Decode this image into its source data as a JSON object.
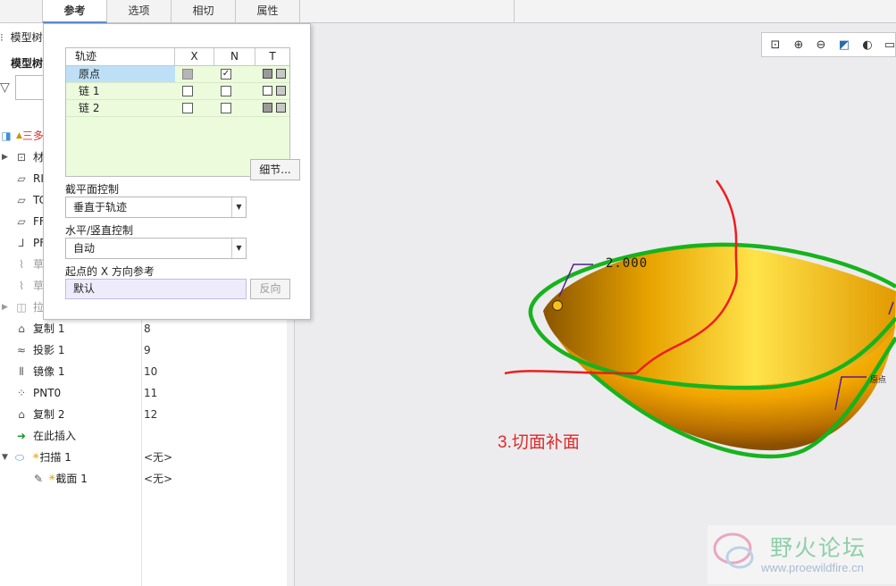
{
  "tabs": [
    {
      "label": "参考",
      "active": true
    },
    {
      "label": "选项",
      "active": false
    },
    {
      "label": "相切",
      "active": false
    },
    {
      "label": "属性",
      "active": false
    }
  ],
  "model_tree": {
    "title": "模型树",
    "subheader": "模型树",
    "rows": [
      {
        "label": "三多",
        "value": "",
        "root": true
      },
      {
        "label": "材",
        "value": ""
      },
      {
        "label": "RI",
        "value": ""
      },
      {
        "label": "TC",
        "value": ""
      },
      {
        "label": "FF",
        "value": ""
      },
      {
        "label": "PF",
        "value": ""
      },
      {
        "label": "草",
        "value": ""
      },
      {
        "label": "草",
        "value": ""
      },
      {
        "label": "拉",
        "value": ""
      },
      {
        "label": "复制 1",
        "value": "8"
      },
      {
        "label": "投影 1",
        "value": "9"
      },
      {
        "label": "镜像 1",
        "value": "10"
      },
      {
        "label": "PNT0",
        "value": "11"
      },
      {
        "label": "复制 2",
        "value": "12"
      },
      {
        "label": "在此插入",
        "value": ""
      },
      {
        "label": "扫描 1",
        "value": "<无>"
      },
      {
        "label": "截面 1",
        "value": "<无>"
      }
    ]
  },
  "dialog": {
    "table": {
      "headers": [
        "轨迹",
        "X",
        "N",
        "T"
      ],
      "rows": [
        {
          "name": "原点",
          "x": "disabled",
          "n": "checked",
          "selected": true
        },
        {
          "name": "链 1",
          "x": "unchecked",
          "n": "unchecked",
          "selected": false
        },
        {
          "name": "链 2",
          "x": "unchecked",
          "n": "unchecked",
          "selected": false
        }
      ]
    },
    "details_button": "细节...",
    "section_plane_label": "截平面控制",
    "section_plane_value": "垂直于轨迹",
    "hv_label": "水平/竖直控制",
    "hv_value": "自动",
    "start_x_label": "起点的 X 方向参考",
    "start_x_value": "默认",
    "flip_button": "反向"
  },
  "graphics": {
    "dimension": "2.000",
    "origin_tag": "原点",
    "annotation": "3.切面补面",
    "watermark_title": "野火论坛",
    "watermark_url": "www.proewildfire.cn"
  },
  "colors": {
    "accent": "#5a8ed0",
    "bowl": "#f0a400",
    "outline": "#16b31d",
    "annotation": "#e02a2a"
  },
  "icons": {
    "view_toolbar": [
      "refit-icon",
      "zoom-in-icon",
      "zoom-out-icon",
      "repaint-icon",
      "display-style-icon",
      "saved-views-icon"
    ]
  }
}
